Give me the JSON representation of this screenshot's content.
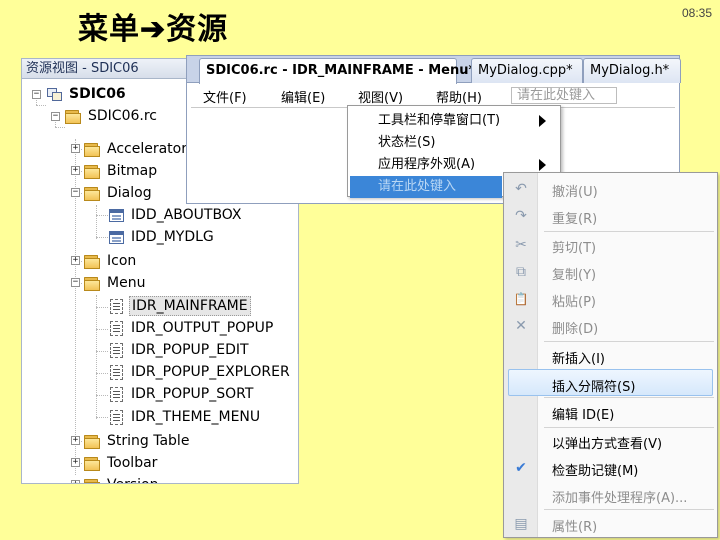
{
  "slide": {
    "title": "菜单➔资源",
    "clock": "08:35"
  },
  "resource_view": {
    "title": "资源视图 - SDIC06",
    "tree": {
      "project": "SDIC06",
      "rc_file": "SDIC06.rc",
      "folders": [
        "Accelerator",
        "Bitmap",
        "Dialog",
        "Icon",
        "Menu",
        "String Table",
        "Toolbar",
        "Version"
      ],
      "dialogs": [
        "IDD_ABOUTBOX",
        "IDD_MYDLG"
      ],
      "menus": [
        "IDR_MAINFRAME",
        "IDR_OUTPUT_POPUP",
        "IDR_POPUP_EDIT",
        "IDR_POPUP_EXPLORER",
        "IDR_POPUP_SORT",
        "IDR_THEME_MENU"
      ],
      "selected_menu": "IDR_MAINFRAME"
    }
  },
  "editor": {
    "tabs": [
      "SDIC06.rc - IDR_MAINFRAME - Menu*",
      "MyDialog.cpp*",
      "MyDialog.h*"
    ],
    "menubar": {
      "items": [
        "文件(F)",
        "编辑(E)",
        "视图(V)",
        "帮助(H)"
      ],
      "type_here": "请在此处键入"
    },
    "view_menu": {
      "items": [
        "工具栏和停靠窗口(T)",
        "状态栏(S)",
        "应用程序外观(A)",
        "请在此处键入"
      ],
      "submenu_flags": [
        true,
        false,
        true,
        true
      ],
      "highlighted_index": 3
    }
  },
  "context_menu": {
    "items": [
      {
        "label": "撤消(U)",
        "icon": "undo-icon",
        "glyph": "↶",
        "disabled": true
      },
      {
        "label": "重复(R)",
        "icon": "redo-icon",
        "glyph": "↷",
        "disabled": true
      },
      {
        "label": "剪切(T)",
        "icon": "cut-icon",
        "glyph": "✂",
        "disabled": true
      },
      {
        "label": "复制(Y)",
        "icon": "copy-icon",
        "glyph": "⧉",
        "disabled": true
      },
      {
        "label": "粘贴(P)",
        "icon": "paste-icon",
        "glyph": "📋",
        "disabled": true
      },
      {
        "label": "删除(D)",
        "icon": "delete-icon",
        "glyph": "✕",
        "disabled": true
      },
      {
        "label": "新插入(I)",
        "icon": "",
        "glyph": "",
        "disabled": false
      },
      {
        "label": "插入分隔符(S)",
        "icon": "",
        "glyph": "",
        "disabled": false,
        "highlighted": true
      },
      {
        "label": "编辑 ID(E)",
        "icon": "",
        "glyph": "",
        "disabled": false
      },
      {
        "label": "以弹出方式查看(V)",
        "icon": "",
        "glyph": "",
        "disabled": false
      },
      {
        "label": "检查助记键(M)",
        "icon": "check-mnemonics-icon",
        "glyph": "✔",
        "disabled": false
      },
      {
        "label": "添加事件处理程序(A)...",
        "icon": "",
        "glyph": "",
        "disabled": true
      },
      {
        "label": "属性(R)",
        "icon": "properties-icon",
        "glyph": "▤",
        "disabled": true
      }
    ]
  },
  "colors": {
    "slide_bg": "#ffff99",
    "menu_highlight": "#3b86d8",
    "context_highlight": "#d6e8fb"
  }
}
